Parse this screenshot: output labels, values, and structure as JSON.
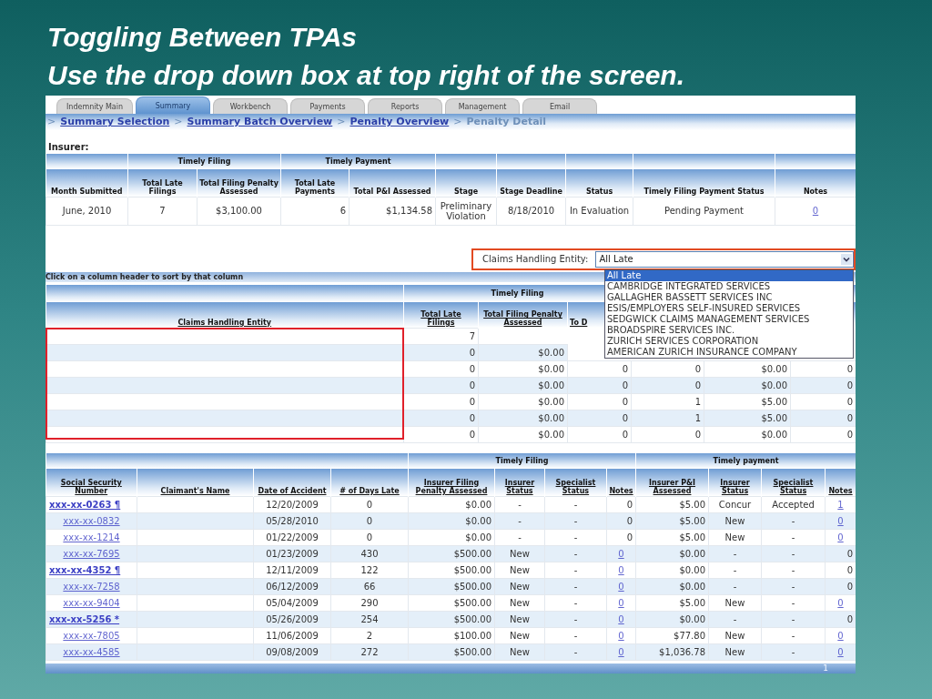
{
  "slide_title": [
    "Toggling Between TPAs",
    "Use the drop down box at top right of the screen."
  ],
  "tabs": [
    {
      "label": "Indemnity Main",
      "selected": false
    },
    {
      "label": "Summary",
      "selected": true
    },
    {
      "label": "Workbench",
      "selected": false
    },
    {
      "label": "Payments",
      "selected": false
    },
    {
      "label": "Reports",
      "selected": false
    },
    {
      "label": "Management",
      "selected": false
    },
    {
      "label": "Email",
      "selected": false
    }
  ],
  "breadcrumb": [
    {
      "label": "Summary Selection",
      "link": true
    },
    {
      "label": "Summary Batch Overview",
      "link": true
    },
    {
      "label": "Penalty Overview",
      "link": true
    },
    {
      "label": "Penalty Detail",
      "link": false
    }
  ],
  "breadcrumb_separator": ">",
  "insurer_label": "Insurer:",
  "summary_table": {
    "groups": [
      {
        "label": "Timely Filing"
      },
      {
        "label": "Timely Payment"
      }
    ],
    "columns": [
      "Month Submitted",
      "Total Late Filings",
      "Total Filing Penalty Assessed",
      "Total Late Payments",
      "Total P&I Assessed",
      "Stage",
      "Stage Deadline",
      "Status",
      "Timely Filing Payment Status",
      "Notes"
    ],
    "row": [
      "June, 2010",
      "7",
      "$3,100.00",
      "6",
      "$1,134.58",
      "Preliminary Violation",
      "8/18/2010",
      "In Evaluation",
      "Pending Payment",
      "0"
    ]
  },
  "entity_filter": {
    "label": "Claims Handling Entity:",
    "value": "All Late",
    "expanded": true,
    "options": [
      {
        "label": "All Late",
        "selected": true
      },
      {
        "label": "CAMBRIDGE INTEGRATED SERVICES",
        "selected": false
      },
      {
        "label": "GALLAGHER BASSETT SERVICES INC",
        "selected": false
      },
      {
        "label": "ESIS/EMPLOYERS SELF-INSURED SERVICES",
        "selected": false
      },
      {
        "label": "SEDGWICK CLAIMS MANAGEMENT SERVICES",
        "selected": false
      },
      {
        "label": "BROADSPIRE SERVICES INC.",
        "selected": false
      },
      {
        "label": "ZURICH SERVICES CORPORATION",
        "selected": false
      },
      {
        "label": "AMERICAN ZURICH INSURANCE COMPANY",
        "selected": false
      }
    ]
  },
  "sort_hint": "Click on a column header to sort by that column",
  "entity_table": {
    "group": "Timely Filing",
    "columns": [
      "Claims Handling Entity",
      "Total Late Filings",
      "Total Filing Penalty Assessed",
      "To D"
    ],
    "rows": [
      [
        "",
        "7"
      ],
      [
        "",
        "0",
        "$0.00"
      ],
      [
        "",
        "0",
        "$0.00",
        "0",
        "0",
        "$0.00",
        "0"
      ],
      [
        "",
        "0",
        "$0.00",
        "0",
        "0",
        "$0.00",
        "0"
      ],
      [
        "",
        "0",
        "$0.00",
        "0",
        "1",
        "$5.00",
        "0"
      ],
      [
        "",
        "0",
        "$0.00",
        "0",
        "1",
        "$5.00",
        "0"
      ],
      [
        "",
        "0",
        "$0.00",
        "0",
        "0",
        "$0.00",
        "0"
      ]
    ]
  },
  "claims_table": {
    "groups": [
      {
        "label": "Timely Filing"
      },
      {
        "label": "Timely payment"
      }
    ],
    "columns": [
      "Social Security Number",
      "Claimant's Name",
      "Date of Accident",
      "# of Days Late",
      "Insurer Filing Penalty Assessed",
      "Insurer Status",
      "Specialist Status",
      "Notes",
      "Insurer P&I Assessed",
      "Insurer Status",
      "Specialist Status",
      "Notes"
    ],
    "rows": [
      {
        "flagged": true,
        "cells": [
          "xxx-xx-0263 ¶",
          "",
          "12/20/2009",
          "0",
          "$0.00",
          "-",
          "-",
          "0",
          "$5.00",
          "Concur",
          "Accepted",
          "1"
        ],
        "filing_notes_link": false,
        "payment_notes_link": true
      },
      {
        "flagged": false,
        "cells": [
          "xxx-xx-0832",
          "",
          "05/28/2010",
          "0",
          "$0.00",
          "-",
          "-",
          "0",
          "$5.00",
          "New",
          "-",
          "0"
        ],
        "filing_notes_link": false,
        "payment_notes_link": true
      },
      {
        "flagged": false,
        "cells": [
          "xxx-xx-1214",
          "",
          "01/22/2009",
          "0",
          "$0.00",
          "-",
          "-",
          "0",
          "$5.00",
          "New",
          "-",
          "0"
        ],
        "filing_notes_link": false,
        "payment_notes_link": true
      },
      {
        "flagged": false,
        "cells": [
          "xxx-xx-7695",
          "",
          "01/23/2009",
          "430",
          "$500.00",
          "New",
          "-",
          "0",
          "$0.00",
          "-",
          "-",
          "0"
        ],
        "filing_notes_link": true,
        "payment_notes_link": false
      },
      {
        "flagged": true,
        "cells": [
          "xxx-xx-4352 ¶",
          "",
          "12/11/2009",
          "122",
          "$500.00",
          "New",
          "-",
          "0",
          "$0.00",
          "-",
          "-",
          "0"
        ],
        "filing_notes_link": true,
        "payment_notes_link": false
      },
      {
        "flagged": false,
        "cells": [
          "xxx-xx-7258",
          "",
          "06/12/2009",
          "66",
          "$500.00",
          "New",
          "-",
          "0",
          "$0.00",
          "-",
          "-",
          "0"
        ],
        "filing_notes_link": true,
        "payment_notes_link": false
      },
      {
        "flagged": false,
        "cells": [
          "xxx-xx-9404",
          "",
          "05/04/2009",
          "290",
          "$500.00",
          "New",
          "-",
          "0",
          "$5.00",
          "New",
          "-",
          "0"
        ],
        "filing_notes_link": true,
        "payment_notes_link": true
      },
      {
        "flagged": true,
        "cells": [
          "xxx-xx-5256 *",
          "",
          "05/26/2009",
          "254",
          "$500.00",
          "New",
          "-",
          "0",
          "$0.00",
          "-",
          "-",
          "0"
        ],
        "filing_notes_link": true,
        "payment_notes_link": false
      },
      {
        "flagged": false,
        "cells": [
          "xxx-xx-7805",
          "",
          "11/06/2009",
          "2",
          "$100.00",
          "New",
          "-",
          "0",
          "$77.80",
          "New",
          "-",
          "0"
        ],
        "filing_notes_link": true,
        "payment_notes_link": true
      },
      {
        "flagged": false,
        "cells": [
          "xxx-xx-4585",
          "",
          "09/08/2009",
          "272",
          "$500.00",
          "New",
          "-",
          "0",
          "$1,036.78",
          "New",
          "-",
          "0"
        ],
        "filing_notes_link": true,
        "payment_notes_link": true
      }
    ],
    "page": "1"
  }
}
